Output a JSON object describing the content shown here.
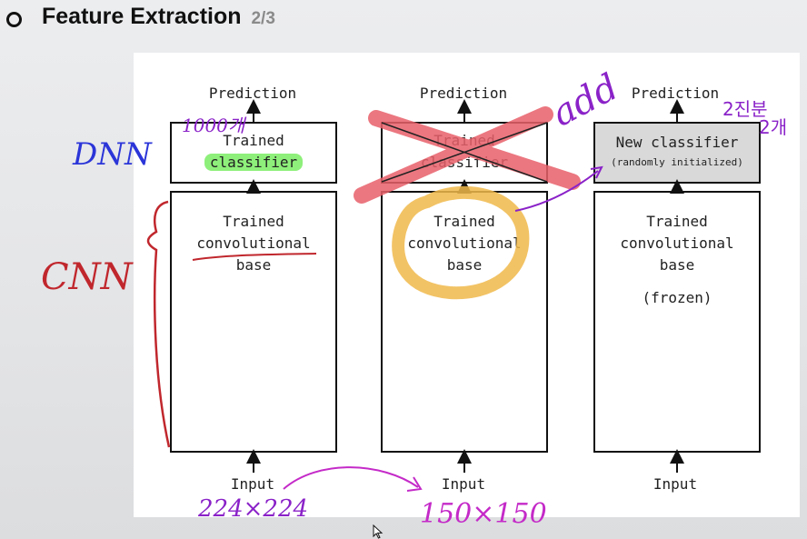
{
  "slide": {
    "title": "Feature Extraction",
    "page": "2/3"
  },
  "diagram": {
    "columns": [
      {
        "prediction": "Prediction",
        "classifier_line1": "Trained",
        "classifier_line2": "classifier",
        "base_line1": "Trained",
        "base_line2": "convolutional",
        "base_line3": "base",
        "input": "Input"
      },
      {
        "prediction": "Prediction",
        "classifier_line1": "Trained",
        "classifier_line2": "classifier",
        "base_line1": "Trained",
        "base_line2": "convolutional",
        "base_line3": "base",
        "input": "Input"
      },
      {
        "prediction": "Prediction",
        "classifier_line1": "New classifier",
        "classifier_line2": "(randomly initialized)",
        "base_line1": "Trained",
        "base_line2": "convolutional",
        "base_line3": "base",
        "base_note": "(frozen)",
        "input": "Input"
      }
    ]
  },
  "annotations": {
    "dnn": "DNN",
    "cnn": "CNN",
    "count_1000": "1000개",
    "add": "add",
    "korean_note_line1": "2진분",
    "korean_note_line2": "2개",
    "input_size_1": "224×224",
    "input_size_2": "150×150"
  },
  "colors": {
    "highlight_green": "#8ef07a",
    "cross_red": "#e8606a",
    "circle_orange": "#f0b94a",
    "ink_blue": "#2b35d8",
    "ink_purple": "#8a22c8",
    "ink_red": "#c0272d",
    "ink_magenta": "#c42ac8",
    "new_classifier_fill": "#d9d9d9"
  }
}
